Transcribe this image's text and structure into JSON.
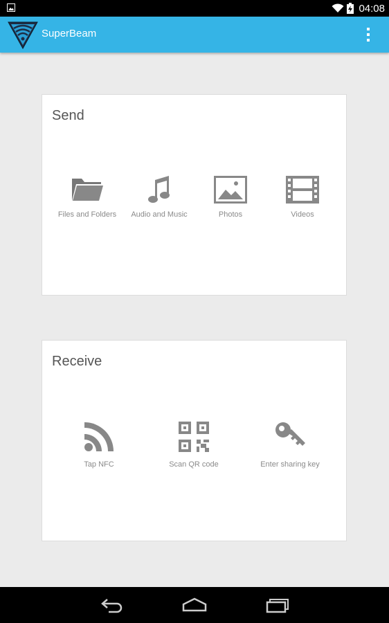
{
  "status_bar": {
    "time": "04:08",
    "icons": [
      "image-notification-icon",
      "wifi-icon",
      "battery-charging-icon"
    ]
  },
  "app_bar": {
    "title": "SuperBeam",
    "accent_color": "#35b4e6",
    "menu_icon": "overflow-menu-icon"
  },
  "send": {
    "title": "Send",
    "options": [
      {
        "label": "Files and Folders",
        "icon": "folder-icon"
      },
      {
        "label": "Audio and Music",
        "icon": "music-note-icon"
      },
      {
        "label": "Photos",
        "icon": "photo-icon"
      },
      {
        "label": "Videos",
        "icon": "film-icon"
      }
    ]
  },
  "receive": {
    "title": "Receive",
    "options": [
      {
        "label": "Tap NFC",
        "icon": "nfc-icon"
      },
      {
        "label": "Scan QR code",
        "icon": "qr-code-icon"
      },
      {
        "label": "Enter sharing key",
        "icon": "key-icon"
      }
    ]
  },
  "nav_bar": {
    "buttons": [
      "back-icon",
      "home-icon",
      "recent-apps-icon"
    ]
  }
}
